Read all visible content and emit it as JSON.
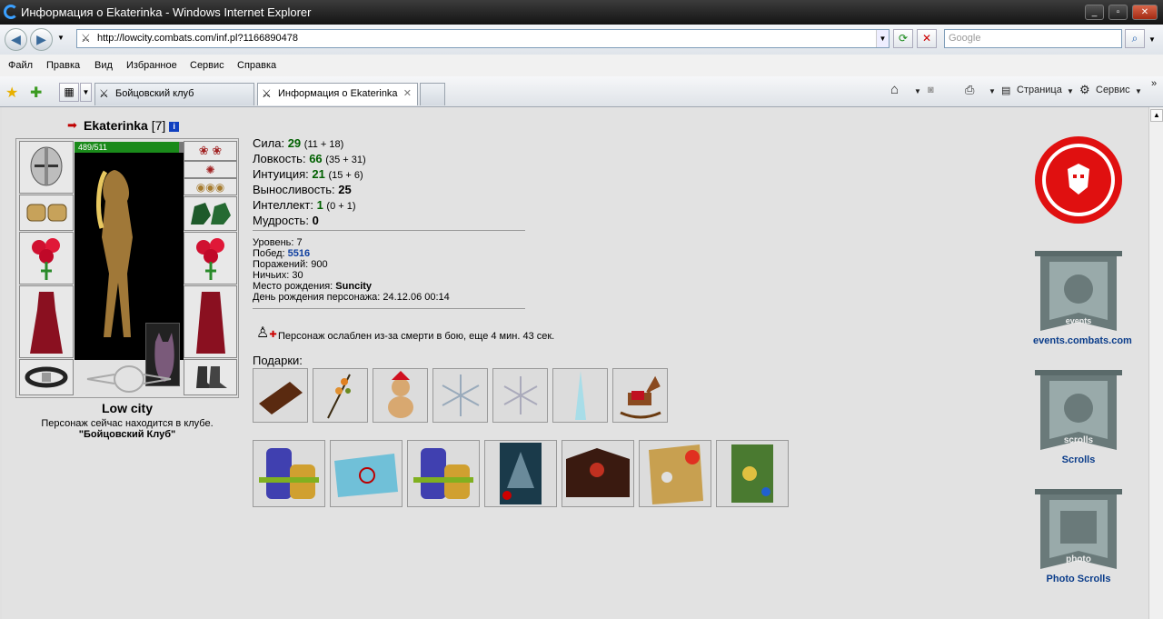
{
  "window": {
    "title": "Информация о Ekaterinka - Windows Internet Explorer"
  },
  "address": {
    "url": "http://lowcity.combats.com/inf.pl?1166890478"
  },
  "search": {
    "placeholder": "Google"
  },
  "menu": [
    "Файл",
    "Правка",
    "Вид",
    "Избранное",
    "Сервис",
    "Справка"
  ],
  "tabs": [
    {
      "label": "Бойцовский клуб"
    },
    {
      "label": "Информация о Ekaterinka"
    }
  ],
  "commands": {
    "page": "Страница",
    "tools": "Сервис"
  },
  "character": {
    "name": "Ekaterinka",
    "level": "[7]",
    "hp": "489/511",
    "hp_fraction": 0.957
  },
  "location": {
    "city": "Low city",
    "status": "Персонаж сейчас находится в клубе.",
    "club": "\"Бойцовский Клуб\""
  },
  "stats": [
    {
      "label": "Сила:",
      "value": "29",
      "detail": "(11 + 18)",
      "color": "#006000"
    },
    {
      "label": "Ловкость:",
      "value": "66",
      "detail": "(35 + 31)",
      "color": "#006000"
    },
    {
      "label": "Интуиция:",
      "value": "21",
      "detail": "(15 + 6)",
      "color": "#006000"
    },
    {
      "label": "Выносливость:",
      "value": "25",
      "detail": "",
      "color": "#000000"
    },
    {
      "label": "Интеллект:",
      "value": "1",
      "detail": "(0 + 1)",
      "color": "#006000"
    },
    {
      "label": "Мудрость:",
      "value": "0",
      "detail": "",
      "color": "#000000"
    }
  ],
  "info": {
    "level_label": "Уровень:",
    "level": "7",
    "wins_label": "Побед:",
    "wins": "5516",
    "losses_label": "Поражений:",
    "losses": "900",
    "draws_label": "Ничьих:",
    "draws": "30",
    "birthplace_label": "Место рождения:",
    "birthplace": "Suncity",
    "birthday_label": "День рождения персонажа:",
    "birthday": "24.12.06 00:14"
  },
  "effect": {
    "text": "Персонаж ослаблен из-за смерти в бою, еще 4 мин. 43 сек."
  },
  "gifts": {
    "label": "Подарки:"
  },
  "banners": [
    {
      "label": "events.combats.com",
      "caption": "events"
    },
    {
      "label": "Scrolls",
      "caption": "scrolls"
    },
    {
      "label": "Photo Scrolls",
      "caption": "photo"
    }
  ]
}
